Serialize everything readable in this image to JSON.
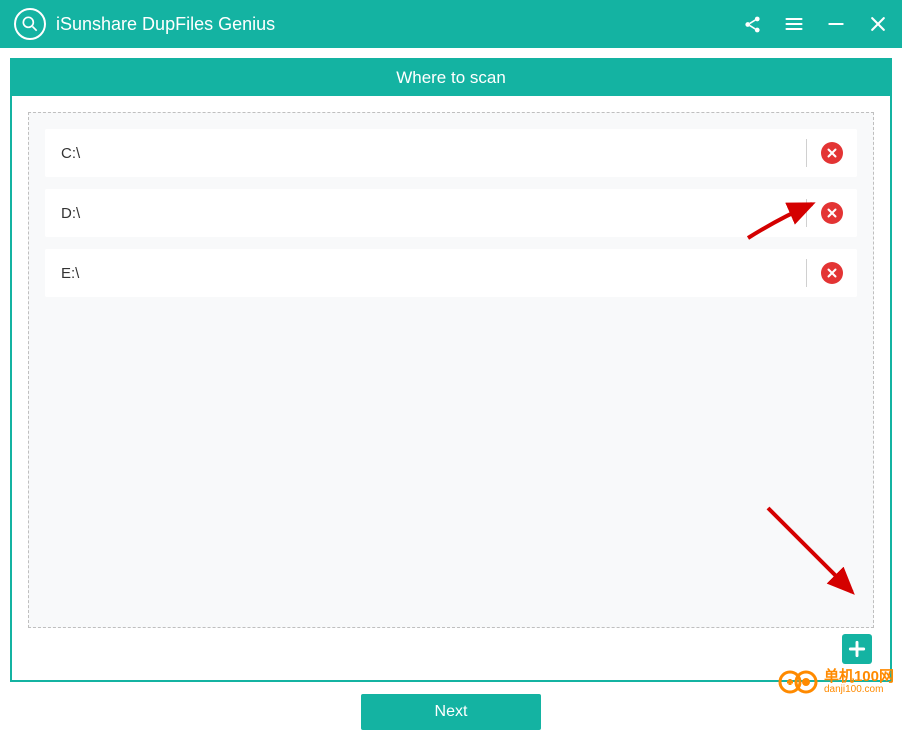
{
  "app": {
    "title": "iSunshare DupFiles Genius"
  },
  "panel": {
    "header": "Where to scan"
  },
  "paths": [
    {
      "value": "C:\\"
    },
    {
      "value": "D:\\"
    },
    {
      "value": "E:\\"
    }
  ],
  "footer": {
    "next_label": "Next"
  },
  "watermark": {
    "line1": "单机100网",
    "line2": "danji100.com"
  }
}
